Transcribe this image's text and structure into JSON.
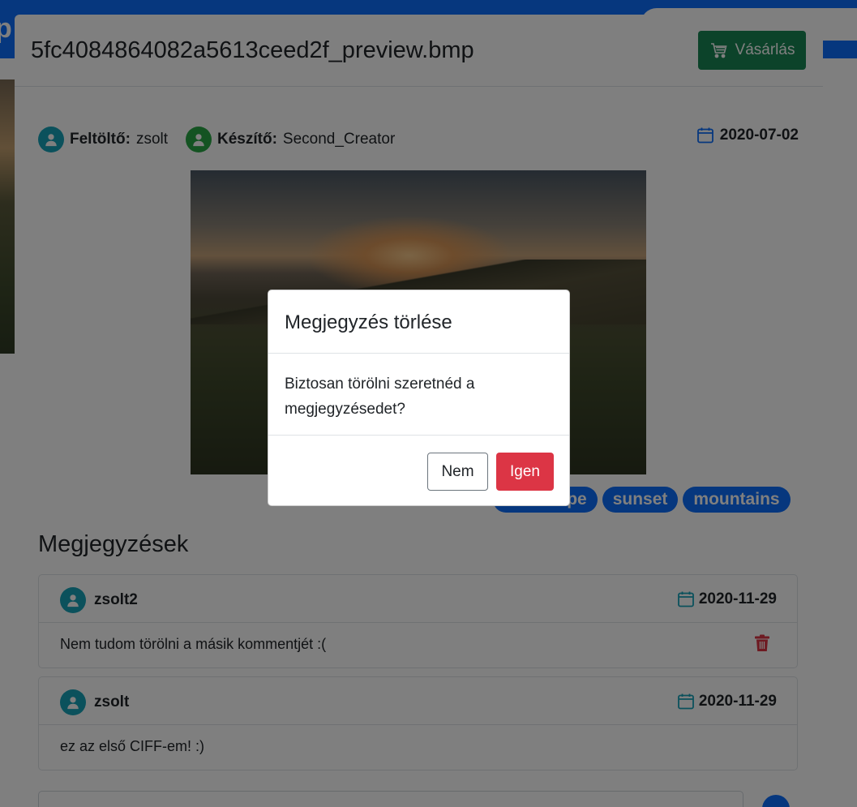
{
  "app": {
    "brand_fragment": "p"
  },
  "preview": {
    "title": "5fc4084864082a5613ceed2f_preview.bmp",
    "buy_label": "Vásárlás",
    "uploader_label": "Feltöltő:",
    "uploader": "zsolt",
    "creator_label": "Készítő:",
    "creator": "Second_Creator",
    "date": "2020-07-02",
    "tags": [
      "landscape",
      "sunset",
      "mountains"
    ]
  },
  "comments": {
    "title": "Megjegyzések",
    "items": [
      {
        "user": "zsolt2",
        "date": "2020-11-29",
        "text": "Nem tudom törölni a másik kommentjét :(",
        "deletable": true
      },
      {
        "user": "zsolt",
        "date": "2020-11-29",
        "text": "ez az első CIFF-em! :)",
        "deletable": false
      }
    ]
  },
  "confirm_dialog": {
    "title": "Megjegyzés törlése",
    "message": "Biztosan törölni szeretnéd a megjegyzésedet?",
    "no_label": "Nem",
    "yes_label": "Igen"
  },
  "colors": {
    "primary": "#0d6efd",
    "success": "#198754",
    "danger": "#dc3545",
    "avatar_teal": "#17a2b8",
    "avatar_green": "#28a745"
  },
  "icons": [
    "cart-icon",
    "user-icon",
    "calendar-icon",
    "trash-icon",
    "send-icon"
  ]
}
